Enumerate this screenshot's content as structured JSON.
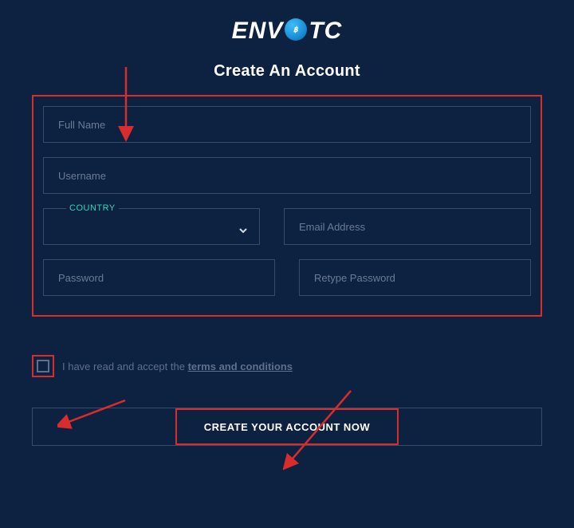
{
  "logo": {
    "left": "ENV",
    "right": "TC",
    "icon_glyph": "฿"
  },
  "heading": "Create An Account",
  "form": {
    "full_name": {
      "placeholder": "Full Name",
      "value": ""
    },
    "username": {
      "placeholder": "Username",
      "value": ""
    },
    "country": {
      "legend": "COUNTRY",
      "value": ""
    },
    "email": {
      "placeholder": "Email Address",
      "value": ""
    },
    "password": {
      "placeholder": "Password",
      "value": ""
    },
    "retype_password": {
      "placeholder": "Retype Password",
      "value": ""
    }
  },
  "terms": {
    "prefix": "I have read and accept the ",
    "link_text": "terms and conditions"
  },
  "submit_label": "CREATE YOUR ACCOUNT NOW"
}
